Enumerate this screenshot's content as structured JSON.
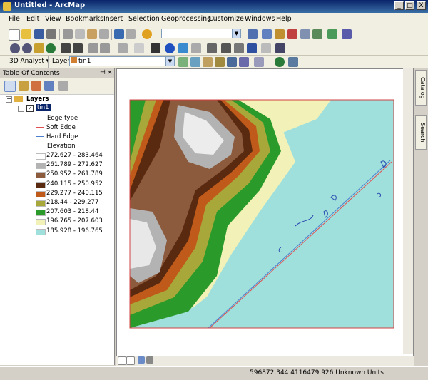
{
  "window": {
    "title": "Untitled - ArcMap",
    "min": "_",
    "max": "□",
    "close": "X"
  },
  "menu": [
    "File",
    "Edit",
    "View",
    "Bookmarks",
    "Insert",
    "Selection",
    "Geoprocessing",
    "Customize",
    "Windows",
    "Help"
  ],
  "toolbar3": {
    "analyst_label": "3D Analyst ▾",
    "layer_label": "Layer:",
    "layer_value": "tin1"
  },
  "toc": {
    "title": "Table Of Contents",
    "root": "Layers",
    "layer": "tin1",
    "edge_heading": "Edge type",
    "edges": [
      {
        "label": "Soft Edge",
        "color": "#e05050"
      },
      {
        "label": "Hard Edge",
        "color": "#4a7fd0"
      }
    ],
    "elev_heading": "Elevation",
    "classes": [
      {
        "label": "272.627 - 283.464",
        "color": "#ffffff"
      },
      {
        "label": "261.789 - 272.627",
        "color": "#b3b3b3"
      },
      {
        "label": "250.952 - 261.789",
        "color": "#8c5a3c"
      },
      {
        "label": "240.115 - 250.952",
        "color": "#5a2a10"
      },
      {
        "label": "229.277 - 240.115",
        "color": "#c05a1a"
      },
      {
        "label": "218.44 - 229.277",
        "color": "#a8a83a"
      },
      {
        "label": "207.603 - 218.44",
        "color": "#2a9a2a"
      },
      {
        "label": "196.765 - 207.603",
        "color": "#f2f2b8"
      },
      {
        "label": "185.928 - 196.765",
        "color": "#a0e0dc"
      }
    ]
  },
  "side_tabs": [
    "Catalog",
    "Search"
  ],
  "status": {
    "coords": "596872.344  4116479.926 Unknown Units"
  }
}
